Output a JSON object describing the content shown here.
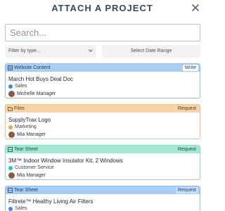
{
  "header": {
    "title": "ATTACH A PROJECT"
  },
  "search": {
    "placeholder": "Search..."
  },
  "filters": {
    "type_label": "Filter by type...",
    "date_label": "Select Date Range"
  },
  "cards": [
    {
      "type": "Website Content",
      "action": "Write",
      "title": "March Hot Buys Deal Doc",
      "tag": "Sales",
      "tag_color": "#3a8ee6",
      "owner": "Michelle Manager",
      "head_bg": "#a9cdf4",
      "border": "#8fbcea",
      "action_bg": "#ffffff",
      "head_text": "#1f3c5a",
      "icon": "document-icon"
    },
    {
      "type": "Files",
      "action": "Request",
      "title": "SupplyTrax Logo",
      "tag": "Marketing",
      "tag_color": "#f5a147",
      "owner": "Mia Manager",
      "head_bg": "#f7d3aa",
      "border": "#efbf8b",
      "action_bg": "#f7d3aa",
      "head_text": "#5a3a1a",
      "icon": "folder-icon"
    },
    {
      "type": "Tear Sheet",
      "action": "Request",
      "title": "3M™ Indoor Window Insulator Kit, 2 Windows",
      "tag": "Customer Service",
      "tag_color": "#2ec7a4",
      "owner": "Mia Manager",
      "head_bg": "#a6e6d6",
      "border": "#88d8c4",
      "action_bg": "#a6e6d6",
      "head_text": "#1c4a40",
      "icon": "sheet-icon"
    },
    {
      "type": "Tear Sheet",
      "action": "Request",
      "title": "Filtrete™ Healthy Living Air Filters",
      "tag": "Sales",
      "tag_color": "#3a8ee6",
      "owner": "",
      "head_bg": "#a9cdf4",
      "border": "#8fbcea",
      "action_bg": "#c7defa",
      "head_text": "#1f3c5a",
      "icon": "sheet-icon"
    }
  ]
}
